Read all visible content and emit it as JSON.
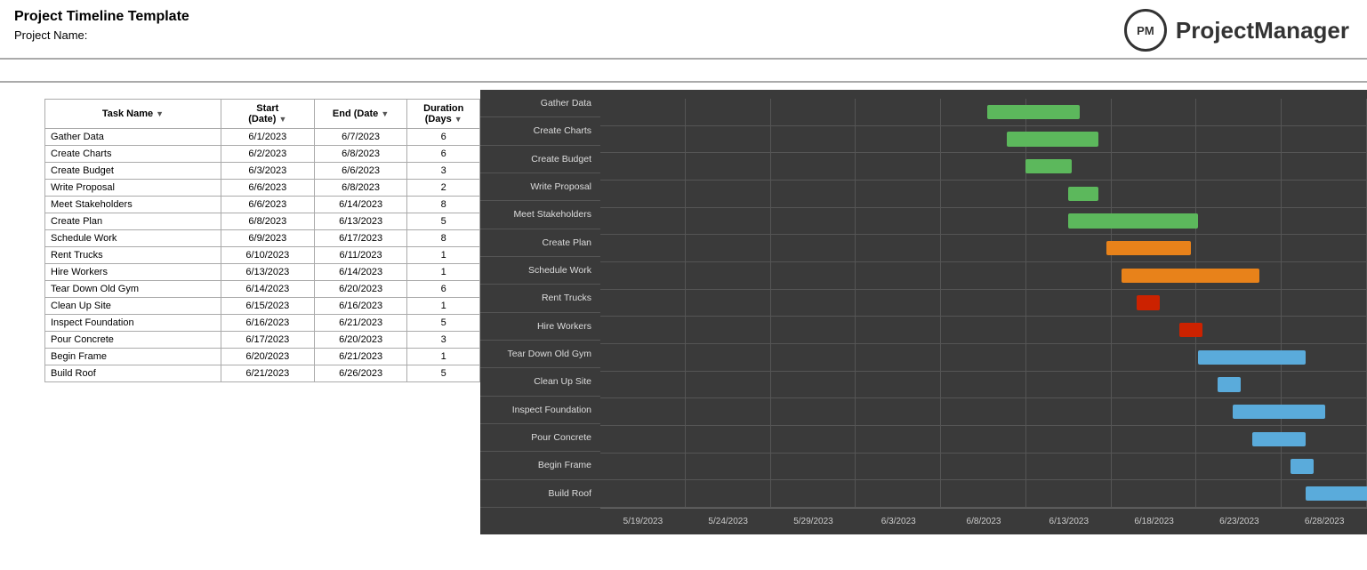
{
  "header": {
    "title": "Project Timeline Template",
    "project_name_label": "Project Name:"
  },
  "logo": {
    "circle_text": "PM",
    "brand_name": "ProjectManager"
  },
  "table": {
    "columns": [
      "Task Name",
      "Start (Date)",
      "End  (Date)",
      "Duration (Days)"
    ],
    "rows": [
      {
        "task": "Gather Data",
        "start": "6/1/2023",
        "end": "6/7/2023",
        "duration": 6
      },
      {
        "task": "Create Charts",
        "start": "6/2/2023",
        "end": "6/8/2023",
        "duration": 6
      },
      {
        "task": "Create Budget",
        "start": "6/3/2023",
        "end": "6/6/2023",
        "duration": 3
      },
      {
        "task": "Write Proposal",
        "start": "6/6/2023",
        "end": "6/8/2023",
        "duration": 2
      },
      {
        "task": "Meet Stakeholders",
        "start": "6/6/2023",
        "end": "6/14/2023",
        "duration": 8
      },
      {
        "task": "Create Plan",
        "start": "6/8/2023",
        "end": "6/13/2023",
        "duration": 5
      },
      {
        "task": "Schedule Work",
        "start": "6/9/2023",
        "end": "6/17/2023",
        "duration": 8
      },
      {
        "task": "Rent Trucks",
        "start": "6/10/2023",
        "end": "6/11/2023",
        "duration": 1
      },
      {
        "task": "Hire Workers",
        "start": "6/13/2023",
        "end": "6/14/2023",
        "duration": 1
      },
      {
        "task": "Tear Down Old Gym",
        "start": "6/14/2023",
        "end": "6/20/2023",
        "duration": 6
      },
      {
        "task": "Clean Up Site",
        "start": "6/15/2023",
        "end": "6/16/2023",
        "duration": 1
      },
      {
        "task": "Inspect Foundation",
        "start": "6/16/2023",
        "end": "6/21/2023",
        "duration": 5
      },
      {
        "task": "Pour Concrete",
        "start": "6/17/2023",
        "end": "6/20/2023",
        "duration": 3
      },
      {
        "task": "Begin Frame",
        "start": "6/20/2023",
        "end": "6/21/2023",
        "duration": 1
      },
      {
        "task": "Build Roof",
        "start": "6/21/2023",
        "end": "6/26/2023",
        "duration": 5
      }
    ]
  },
  "gantt": {
    "axis_labels": [
      "5/19/2023",
      "5/24/2023",
      "5/29/2023",
      "6/3/2023",
      "6/8/2023",
      "6/13/2023",
      "6/18/2023",
      "6/23/2023",
      "6/28/2023"
    ],
    "row_labels": [
      "Gather Data",
      "Create Charts",
      "Create Budget",
      "Write Proposal",
      "Meet Stakeholders",
      "Create Plan",
      "Schedule Work",
      "Rent Trucks",
      "Hire Workers",
      "Tear Down Old Gym",
      "Clean Up Site",
      "Inspect Foundation",
      "Pour Concrete",
      "Begin Frame",
      "Build Roof"
    ],
    "bars": [
      {
        "left_pct": 50.5,
        "width_pct": 12,
        "color": "bar-green"
      },
      {
        "left_pct": 53,
        "width_pct": 12,
        "color": "bar-green"
      },
      {
        "left_pct": 55.5,
        "width_pct": 6,
        "color": "bar-green"
      },
      {
        "left_pct": 61,
        "width_pct": 4,
        "color": "bar-green"
      },
      {
        "left_pct": 61,
        "width_pct": 17,
        "color": "bar-green"
      },
      {
        "left_pct": 66,
        "width_pct": 11,
        "color": "bar-orange"
      },
      {
        "left_pct": 68,
        "width_pct": 18,
        "color": "bar-orange"
      },
      {
        "left_pct": 70,
        "width_pct": 3,
        "color": "bar-red"
      },
      {
        "left_pct": 75.5,
        "width_pct": 3,
        "color": "bar-red"
      },
      {
        "left_pct": 78,
        "width_pct": 14,
        "color": "bar-blue"
      },
      {
        "left_pct": 80.5,
        "width_pct": 3,
        "color": "bar-blue"
      },
      {
        "left_pct": 82.5,
        "width_pct": 12,
        "color": "bar-blue"
      },
      {
        "left_pct": 85,
        "width_pct": 7,
        "color": "bar-blue"
      },
      {
        "left_pct": 90,
        "width_pct": 3,
        "color": "bar-blue"
      },
      {
        "left_pct": 92,
        "width_pct": 12,
        "color": "bar-blue"
      }
    ]
  }
}
